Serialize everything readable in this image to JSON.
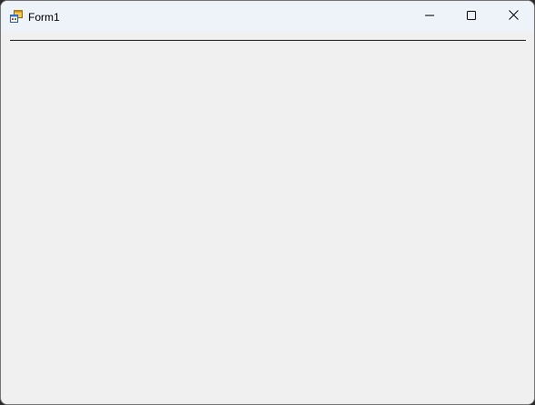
{
  "window": {
    "title": "Form1",
    "icon": "winforms-app-icon"
  },
  "caption_buttons": {
    "minimize_icon": "minimize-icon",
    "maximize_icon": "maximize-icon",
    "close_icon": "close-icon"
  },
  "colors": {
    "titlebar": "#eef3fa",
    "client": "#f0f0f0",
    "divider": "#1a1a1a"
  }
}
